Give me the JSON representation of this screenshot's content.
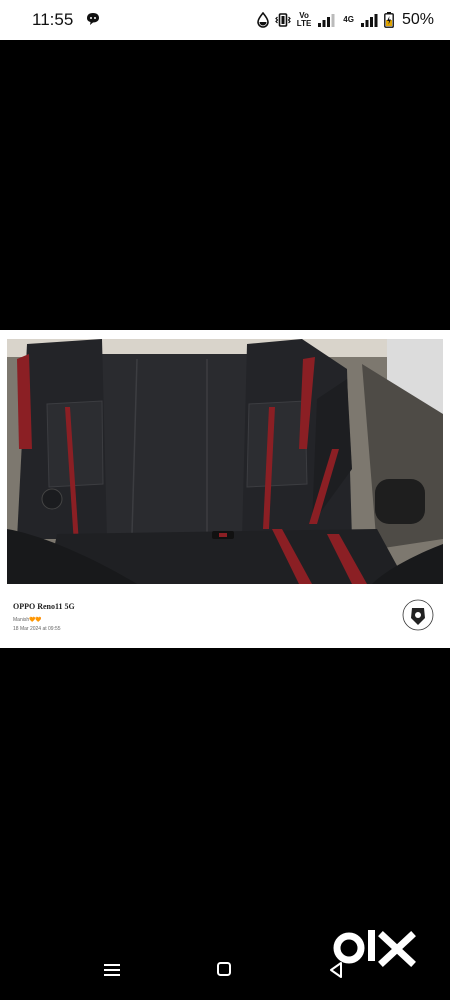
{
  "status_bar": {
    "time": "11:55",
    "notification_icon": "chat-bubble-icon",
    "volte_top": "Vo",
    "volte_mid": "LTE",
    "network_type": "4G",
    "battery_percent": "50%"
  },
  "photo": {
    "description_icon": "car-rear-seat-photo"
  },
  "watermark": {
    "device": "OPPO Reno11 5G",
    "user": "Manish🧡🧡",
    "timestamp": "18 Mar 2024 at 09:55"
  },
  "brand_watermark": "olx",
  "nav": {
    "menu_icon": "menu-icon",
    "home_icon": "home-icon",
    "back_icon": "back-icon"
  }
}
